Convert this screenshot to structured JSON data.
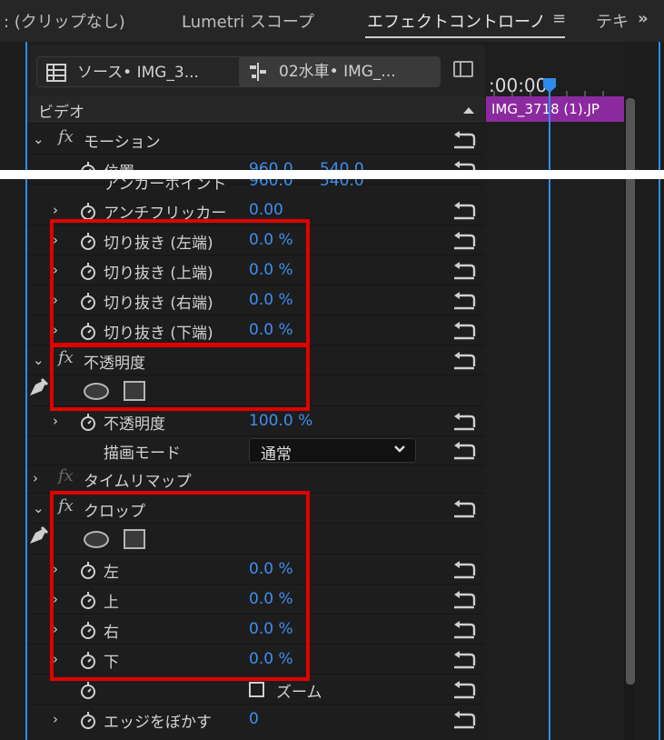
{
  "tabs": [
    {
      "label": ": (クリップなし)"
    },
    {
      "label": "Lumetri スコープ"
    },
    {
      "label": "エフェクトコントローノ"
    },
    {
      "label": "≡"
    },
    {
      "label": "テキ"
    },
    {
      "label": "»"
    }
  ],
  "source_chips": {
    "source": "ソース• IMG_3...",
    "clip": "02水車• IMG_..."
  },
  "timeline": {
    "timecode": ":00:00",
    "clip_label": "IMG_3718 (1).JP"
  },
  "section": {
    "title": "ビデオ"
  },
  "rows": {
    "motion": {
      "label": "モーション"
    },
    "position": {
      "label": "位置",
      "v1": "960.0",
      "v2": "540.0"
    },
    "anchor": {
      "label": "アンカーポイント",
      "v1": "960.0",
      "v2": "540.0"
    },
    "antiflicker": {
      "label": "アンチフリッカー",
      "value": "0.00"
    },
    "crop_left": {
      "label": "切り抜き (左端)",
      "value": "0.0 %"
    },
    "crop_top": {
      "label": "切り抜き (上端)",
      "value": "0.0 %"
    },
    "crop_right": {
      "label": "切り抜き (右端)",
      "value": "0.0 %"
    },
    "crop_bottom": {
      "label": "切り抜き (下端)",
      "value": "0.0 %"
    },
    "opacity_fx": {
      "label": "不透明度"
    },
    "opacity": {
      "label": "不透明度",
      "value": "100.0 %"
    },
    "blend": {
      "label": "描画モード",
      "value": "通常"
    },
    "time_remap": {
      "label": "タイムリマップ"
    },
    "crop_fx": {
      "label": "クロップ"
    },
    "c_left": {
      "label": "左",
      "value": "0.0 %"
    },
    "c_top": {
      "label": "上",
      "value": "0.0 %"
    },
    "c_right": {
      "label": "右",
      "value": "0.0 %"
    },
    "c_bottom": {
      "label": "下",
      "value": "0.0 %"
    },
    "zoom": {
      "label": "ズーム"
    },
    "edge_feather": {
      "label": "エッジをぼかす",
      "value": "0"
    }
  },
  "colors": {
    "accent_blue": "#3f8ff0",
    "clip_purple": "#8b2a9e",
    "highlight_red": "#e00000"
  }
}
